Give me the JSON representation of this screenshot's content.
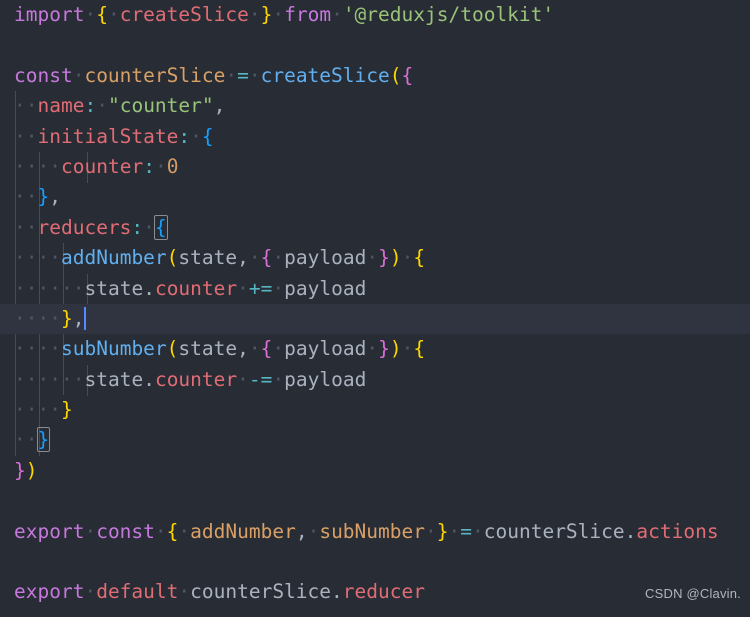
{
  "editor": {
    "language": "javascript",
    "filename_hint": "counterSlice",
    "theme": "One Dark",
    "background_color": "#282c34",
    "active_line_color": "#2f3440",
    "cursor_color": "#528bff",
    "active_line_number": 11,
    "cursor_line_text": "  },",
    "indent_guide_color": "#4b5263"
  },
  "code": {
    "lines": [
      "import { createSlice } from '@reduxjs/toolkit'",
      "",
      "const counterSlice = createSlice({",
      "  name: \"counter\",",
      "  initialState: {",
      "    counter: 0",
      "  },",
      "  reducers: {",
      "    addNumber(state, { payload }) {",
      "      state.counter += payload",
      "    },",
      "    subNumber(state, { payload }) {",
      "      state.counter -= payload",
      "    }",
      "  }",
      "})",
      "",
      "export const { addNumber, subNumber } = counterSlice.actions",
      "",
      "export default counterSlice.reducer"
    ],
    "tokens": {
      "line1": {
        "kw_import": "import",
        "brace_open": "{",
        "ident_createSlice": "createSlice",
        "brace_close": "}",
        "kw_from": "from",
        "module_string": "'@reduxjs/toolkit'"
      },
      "line3": {
        "kw_const": "const",
        "var_name": "counterSlice",
        "op_assign": "=",
        "call_createSlice": "createSlice",
        "paren_open": "(",
        "brace_open": "{"
      },
      "line4": {
        "key": "name",
        "colon": ":",
        "value": "\"counter\"",
        "comma": ","
      },
      "line5": {
        "key": "initialState",
        "colon": ":",
        "brace_open": "{"
      },
      "line6": {
        "key": "counter",
        "colon": ":",
        "value": "0"
      },
      "line7": {
        "brace_close": "}",
        "comma": ","
      },
      "line8": {
        "key": "reducers",
        "colon": ":",
        "brace_open": "{"
      },
      "line9": {
        "method": "addNumber",
        "paren_open": "(",
        "param_state": "state",
        "comma": ",",
        "destr_open": "{",
        "param_payload": "payload",
        "destr_close": "}",
        "paren_close": ")",
        "body_open": "{"
      },
      "line10": {
        "obj": "state",
        "dot": ".",
        "prop": "counter",
        "op": "+=",
        "value": "payload"
      },
      "line11": {
        "brace_close": "}",
        "comma": ","
      },
      "line12": {
        "method": "subNumber",
        "paren_open": "(",
        "param_state": "state",
        "comma": ",",
        "destr_open": "{",
        "param_payload": "payload",
        "destr_close": "}",
        "paren_close": ")",
        "body_open": "{"
      },
      "line13": {
        "obj": "state",
        "dot": ".",
        "prop": "counter",
        "op": "-=",
        "value": "payload"
      },
      "line14": {
        "brace_close": "}"
      },
      "line15": {
        "brace_close": "}"
      },
      "line16": {
        "brace_close": "}",
        "paren_close": ")"
      },
      "line18": {
        "kw_export": "export",
        "kw_const": "const",
        "brace_open": "{",
        "ident_add": "addNumber",
        "comma": ",",
        "ident_sub": "subNumber",
        "brace_close": "}",
        "op_assign": "=",
        "obj": "counterSlice",
        "dot": ".",
        "prop": "actions"
      },
      "line20": {
        "kw_export": "export",
        "kw_default": "default",
        "obj": "counterSlice",
        "dot": ".",
        "prop": "reducer"
      }
    },
    "whitespace_dot": "·"
  },
  "watermark": {
    "text": "CSDN @Clavin."
  }
}
